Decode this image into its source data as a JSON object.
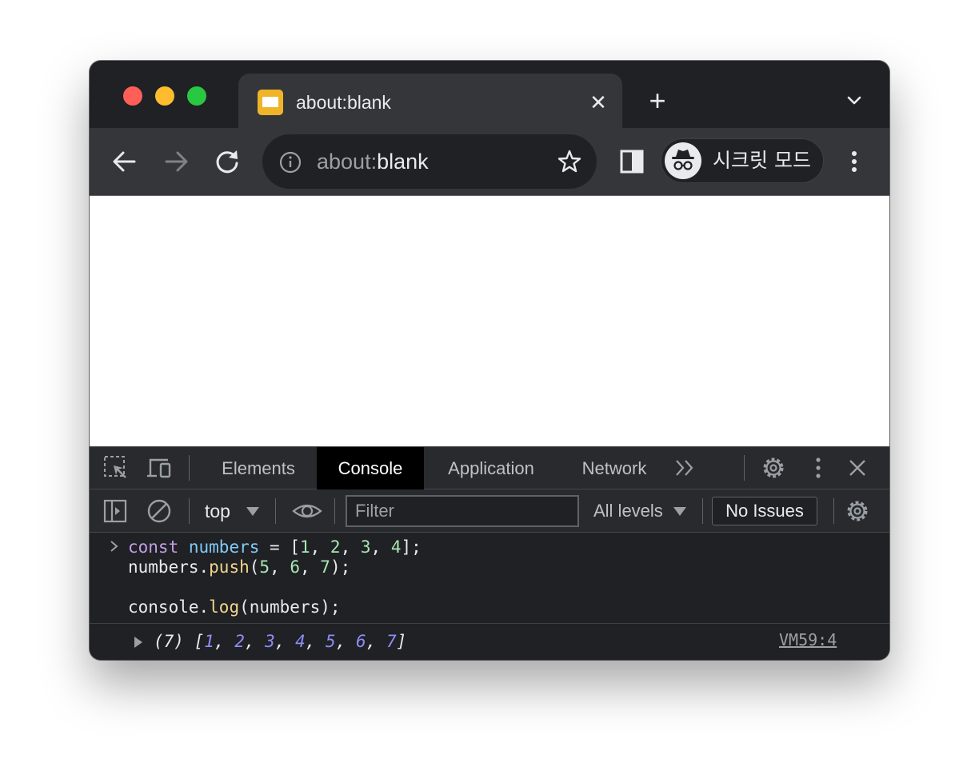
{
  "browser": {
    "tab": {
      "title": "about:blank",
      "close_glyph": "✕"
    },
    "new_tab_glyph": "+",
    "omnibox": {
      "scheme": "about:",
      "host": "blank"
    },
    "profile_label": "시크릿 모드",
    "icons": [
      "back-icon",
      "forward-icon",
      "reload-icon",
      "info-icon",
      "star-icon",
      "side-panel-icon",
      "incognito-icon",
      "more-menu-icon",
      "tab-search-icon"
    ]
  },
  "devtools": {
    "tabs": [
      {
        "label": "Elements",
        "active": false
      },
      {
        "label": "Console",
        "active": true
      },
      {
        "label": "Application",
        "active": false
      },
      {
        "label": "Network",
        "active": false
      }
    ],
    "more_tabs_glyph": "»",
    "toolbar": {
      "context": "top",
      "filter_placeholder": "Filter",
      "levels": "All levels",
      "issues": "No Issues"
    },
    "console": {
      "input_lines": [
        {
          "parts": [
            [
              "const",
              "kw"
            ],
            [
              " ",
              ""
            ],
            [
              "numbers",
              "var"
            ],
            [
              " = [",
              ""
            ],
            [
              "1",
              "num"
            ],
            [
              ", ",
              ""
            ],
            [
              "2",
              "num"
            ],
            [
              ", ",
              ""
            ],
            [
              "3",
              "num"
            ],
            [
              ", ",
              ""
            ],
            [
              "4",
              "num"
            ],
            [
              "];",
              ""
            ]
          ]
        },
        {
          "parts": [
            [
              "numbers.",
              ""
            ],
            [
              "push",
              "fn"
            ],
            [
              "(",
              ""
            ],
            [
              "5",
              "num"
            ],
            [
              ", ",
              ""
            ],
            [
              "6",
              "num"
            ],
            [
              ", ",
              ""
            ],
            [
              "7",
              "num"
            ],
            [
              ");",
              ""
            ]
          ]
        },
        {
          "parts": []
        },
        {
          "parts": [
            [
              "console.",
              ""
            ],
            [
              "log",
              "fn"
            ],
            [
              "(numbers);",
              ""
            ]
          ]
        }
      ],
      "output": {
        "length_label": "(7)",
        "values": [
          "1",
          "2",
          "3",
          "4",
          "5",
          "6",
          "7"
        ],
        "source": "VM59:4"
      }
    }
  },
  "colors": {
    "keyword": "#c39fe8",
    "variable": "#80cbf7",
    "number": "#a8e6b4",
    "function": "#f2d58d",
    "output_number": "#8d8cf7"
  }
}
